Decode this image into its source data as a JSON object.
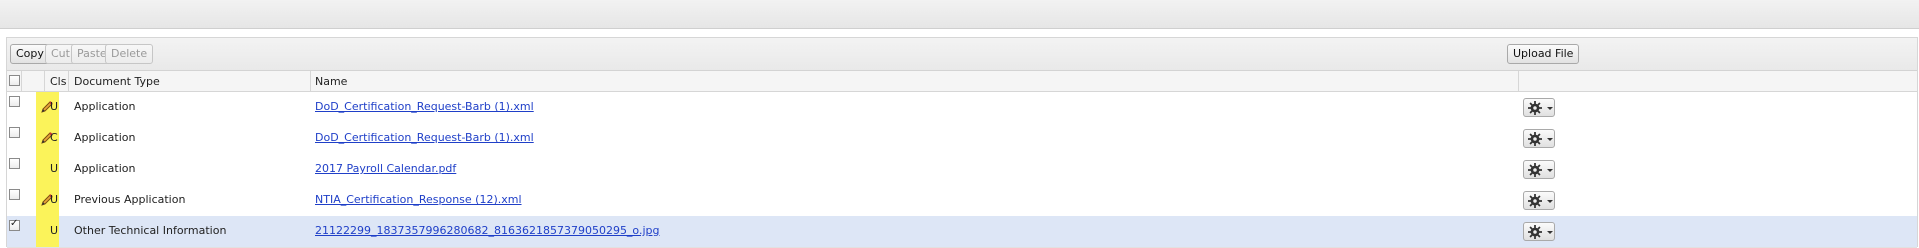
{
  "toolbar": {
    "copy": "Copy",
    "cut": "Cut",
    "paste": "Paste",
    "delete": "Delete",
    "upload": "Upload File"
  },
  "columns": {
    "cls": "Cls",
    "doctype": "Document Type",
    "name": "Name"
  },
  "rows": [
    {
      "checked": false,
      "editable": true,
      "cls": "U",
      "doctype": "Application",
      "name": "DoD_Certification_Request-Barb (1).xml"
    },
    {
      "checked": false,
      "editable": true,
      "cls": "C",
      "doctype": "Application",
      "name": "DoD_Certification_Request-Barb (1).xml"
    },
    {
      "checked": false,
      "editable": false,
      "cls": "U",
      "doctype": "Application",
      "name": "2017 Payroll Calendar.pdf"
    },
    {
      "checked": false,
      "editable": true,
      "cls": "U",
      "doctype": "Previous Application",
      "name": "NTIA_Certification_Response (12).xml"
    },
    {
      "checked": true,
      "editable": false,
      "cls": "U",
      "doctype": "Other Technical Information",
      "name": "21122299_1837357996280682_8163621857379050295_o.jpg"
    }
  ],
  "colors": {
    "highlight": "#fbf35a",
    "selected_row": "#dde6f6",
    "link": "#1f3fc8"
  },
  "icons": {
    "edit": "pencil-icon",
    "actions": "gear-icon"
  }
}
